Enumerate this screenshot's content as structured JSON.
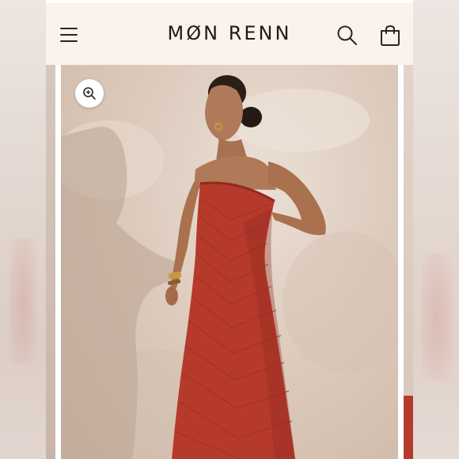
{
  "header": {
    "brand": "MØN RENN",
    "background": "#faf2ec",
    "icons": {
      "menu": "hamburger-menu-icon",
      "search": "search-icon",
      "cart": "shopping-bag-icon"
    }
  },
  "gallery": {
    "zoom_icon": "zoom-in-icon",
    "product_photo": "model-wearing-red-strapless-maxi-dress",
    "colors": {
      "dress": "#b63a2b",
      "backdrop": "#ddcbbd"
    }
  }
}
